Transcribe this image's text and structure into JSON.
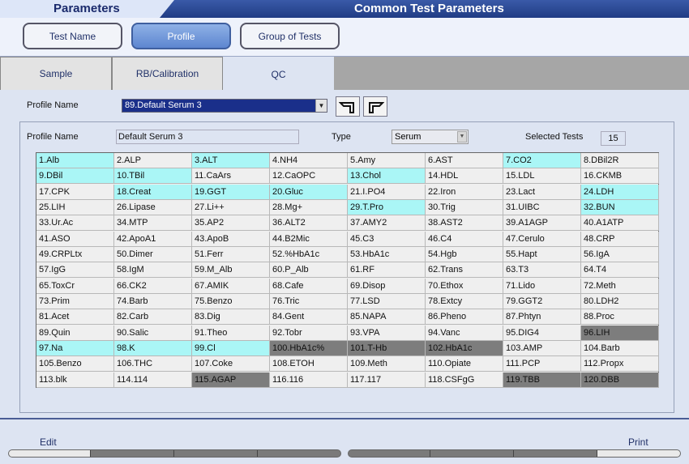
{
  "header": {
    "left_title": "Parameters",
    "right_title": "Common Test Parameters"
  },
  "top_buttons": [
    {
      "label": "Test Name",
      "selected": false
    },
    {
      "label": "Profile",
      "selected": true
    },
    {
      "label": "Group of Tests",
      "selected": false
    }
  ],
  "tabs": [
    {
      "label": "Sample",
      "selected": false
    },
    {
      "label": "RB/Calibration",
      "selected": false
    },
    {
      "label": "QC",
      "selected": true
    }
  ],
  "profile_select": {
    "label": "Profile Name",
    "value": "89.Default Serum 3"
  },
  "form": {
    "profile_name_label": "Profile Name",
    "profile_name_value": "Default Serum 3",
    "type_label": "Type",
    "type_value": "Serum",
    "selected_tests_label": "Selected Tests",
    "selected_tests_value": "15"
  },
  "colors": {
    "selected_cell": "#aaf6f6",
    "unavailable_cell": "#7d7d7d",
    "normal_cell": "#efefef"
  },
  "tests": [
    [
      "1.Alb",
      "2.ALP",
      "3.ALT",
      "4.NH4",
      "5.Amy",
      "6.AST",
      "7.CO2",
      "8.DBil2R"
    ],
    [
      "9.DBil",
      "10.TBil",
      "11.CaArs",
      "12.CaOPC",
      "13.Chol",
      "14.HDL",
      "15.LDL",
      "16.CKMB"
    ],
    [
      "17.CPK",
      "18.Creat",
      "19.GGT",
      "20.Gluc",
      "21.I.PO4",
      "22.Iron",
      "23.Lact",
      "24.LDH"
    ],
    [
      "25.LIH",
      "26.Lipase",
      "27.Li++",
      "28.Mg+",
      "29.T.Pro",
      "30.Trig",
      "31.UIBC",
      "32.BUN"
    ],
    [
      "33.Ur.Ac",
      "34.MTP",
      "35.AP2",
      "36.ALT2",
      "37.AMY2",
      "38.AST2",
      "39.A1AGP",
      "40.A1ATP"
    ],
    [
      "41.ASO",
      "42.ApoA1",
      "43.ApoB",
      "44.B2Mic",
      "45.C3",
      "46.C4",
      "47.Cerulo",
      "48.CRP"
    ],
    [
      "49.CRPLtx",
      "50.Dimer",
      "51.Ferr",
      "52.%HbA1c",
      "53.HbA1c",
      "54.Hgb",
      "55.Hapt",
      "56.IgA"
    ],
    [
      "57.IgG",
      "58.IgM",
      "59.M_Alb",
      "60.P_Alb",
      "61.RF",
      "62.Trans",
      "63.T3",
      "64.T4"
    ],
    [
      "65.ToxCr",
      "66.CK2",
      "67.AMIK",
      "68.Cafe",
      "69.Disop",
      "70.Ethox",
      "71.Lido",
      "72.Meth"
    ],
    [
      "73.Prim",
      "74.Barb",
      "75.Benzo",
      "76.Tric",
      "77.LSD",
      "78.Extcy",
      "79.GGT2",
      "80.LDH2"
    ],
    [
      "81.Acet",
      "82.Carb",
      "83.Dig",
      "84.Gent",
      "85.NAPA",
      "86.Pheno",
      "87.Phtyn",
      "88.Proc"
    ],
    [
      "89.Quin",
      "90.Salic",
      "91.Theo",
      "92.Tobr",
      "93.VPA",
      "94.Vanc",
      "95.DIG4",
      "96.LIH"
    ],
    [
      "97.Na",
      "98.K",
      "99.Cl",
      "100.HbA1c%",
      "101.T-Hb",
      "102.HbA1c",
      "103.AMP",
      "104.Barb"
    ],
    [
      "105.Benzo",
      "106.THC",
      "107.Coke",
      "108.ETOH",
      "109.Meth",
      "110.Opiate",
      "111.PCP",
      "112.Propx"
    ],
    [
      "113.blk",
      "114.114",
      "115.AGAP",
      "116.116",
      "117.117",
      "118.CSFgG",
      "119.TBB",
      "120.DBB"
    ]
  ],
  "cell_states": [
    [
      "c",
      "n",
      "c",
      "n",
      "n",
      "n",
      "c",
      "n"
    ],
    [
      "c",
      "c",
      "n",
      "n",
      "c",
      "n",
      "n",
      "n"
    ],
    [
      "n",
      "c",
      "c",
      "c",
      "n",
      "n",
      "n",
      "c"
    ],
    [
      "n",
      "n",
      "n",
      "n",
      "c",
      "n",
      "n",
      "c"
    ],
    [
      "n",
      "n",
      "n",
      "n",
      "n",
      "n",
      "n",
      "n"
    ],
    [
      "n",
      "n",
      "n",
      "n",
      "n",
      "n",
      "n",
      "n"
    ],
    [
      "n",
      "n",
      "n",
      "n",
      "n",
      "n",
      "n",
      "n"
    ],
    [
      "n",
      "n",
      "n",
      "n",
      "n",
      "n",
      "n",
      "n"
    ],
    [
      "n",
      "n",
      "n",
      "n",
      "n",
      "n",
      "n",
      "n"
    ],
    [
      "n",
      "n",
      "n",
      "n",
      "n",
      "n",
      "n",
      "n"
    ],
    [
      "n",
      "n",
      "n",
      "n",
      "n",
      "n",
      "n",
      "n"
    ],
    [
      "n",
      "n",
      "n",
      "n",
      "n",
      "n",
      "n",
      "g"
    ],
    [
      "c",
      "c",
      "c",
      "g",
      "g",
      "g",
      "n",
      "n"
    ],
    [
      "n",
      "n",
      "n",
      "n",
      "n",
      "n",
      "n",
      "n"
    ],
    [
      "n",
      "n",
      "g",
      "n",
      "n",
      "n",
      "g",
      "g"
    ]
  ],
  "bottom": {
    "edit_label": "Edit",
    "print_label": "Print"
  }
}
